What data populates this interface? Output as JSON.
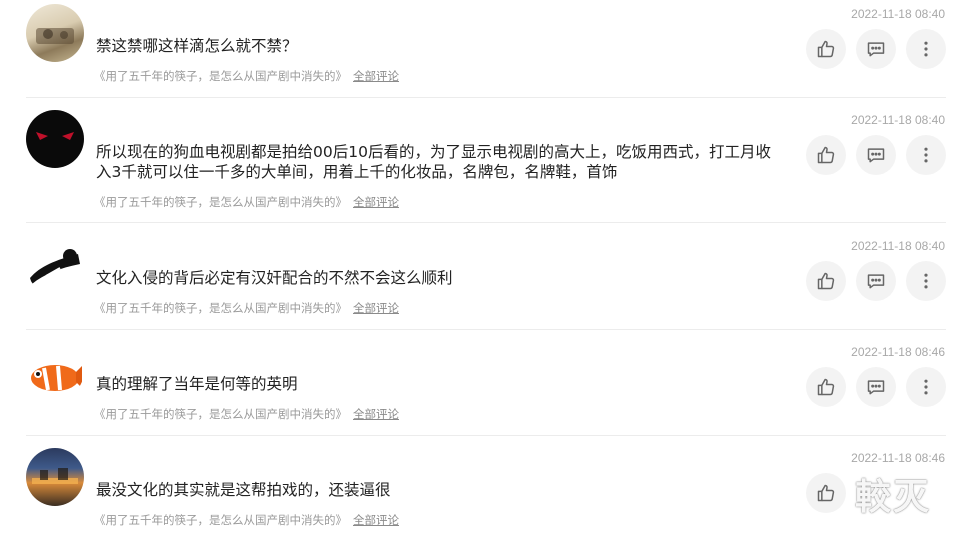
{
  "comments": [
    {
      "text": "禁这禁哪这样滴怎么就不禁？",
      "timestamp": "2022-11-18 08:40",
      "source": "《用了五千年的筷子，是怎么从国产剧中消失的》",
      "link": "全部评论"
    },
    {
      "text": "所以现在的狗血电视剧都是拍给00后10后看的，为了显示电视剧的高大上，吃饭用西式，打工月收入3千就可以住一千多的大单间，用着上千的化妆品，名牌包，名牌鞋，首饰",
      "timestamp": "2022-11-18 08:40",
      "source": "《用了五千年的筷子，是怎么从国产剧中消失的》",
      "link": "全部评论"
    },
    {
      "text": "文化入侵的背后必定有汉奸配合的不然不会这么顺利",
      "timestamp": "2022-11-18 08:40",
      "source": "《用了五千年的筷子，是怎么从国产剧中消失的》",
      "link": "全部评论"
    },
    {
      "text": "真的理解了当年是何等的英明",
      "timestamp": "2022-11-18 08:46",
      "source": "《用了五千年的筷子，是怎么从国产剧中消失的》",
      "link": "全部评论"
    },
    {
      "text": "最没文化的其实就是这帮拍戏的，还装逼很",
      "timestamp": "2022-11-18 08:46",
      "source": "《用了五千年的筷子，是怎么从国产剧中消失的》",
      "link": "全部评论"
    }
  ],
  "icons": {
    "like": "thumbs-up-icon",
    "reply": "comment-icon",
    "more": "more-vertical-icon"
  },
  "colors": {
    "text": "#222222",
    "meta": "#9a9a9a",
    "button_bg": "#f3f3f3",
    "icon": "#666666"
  },
  "watermark": "較灭"
}
